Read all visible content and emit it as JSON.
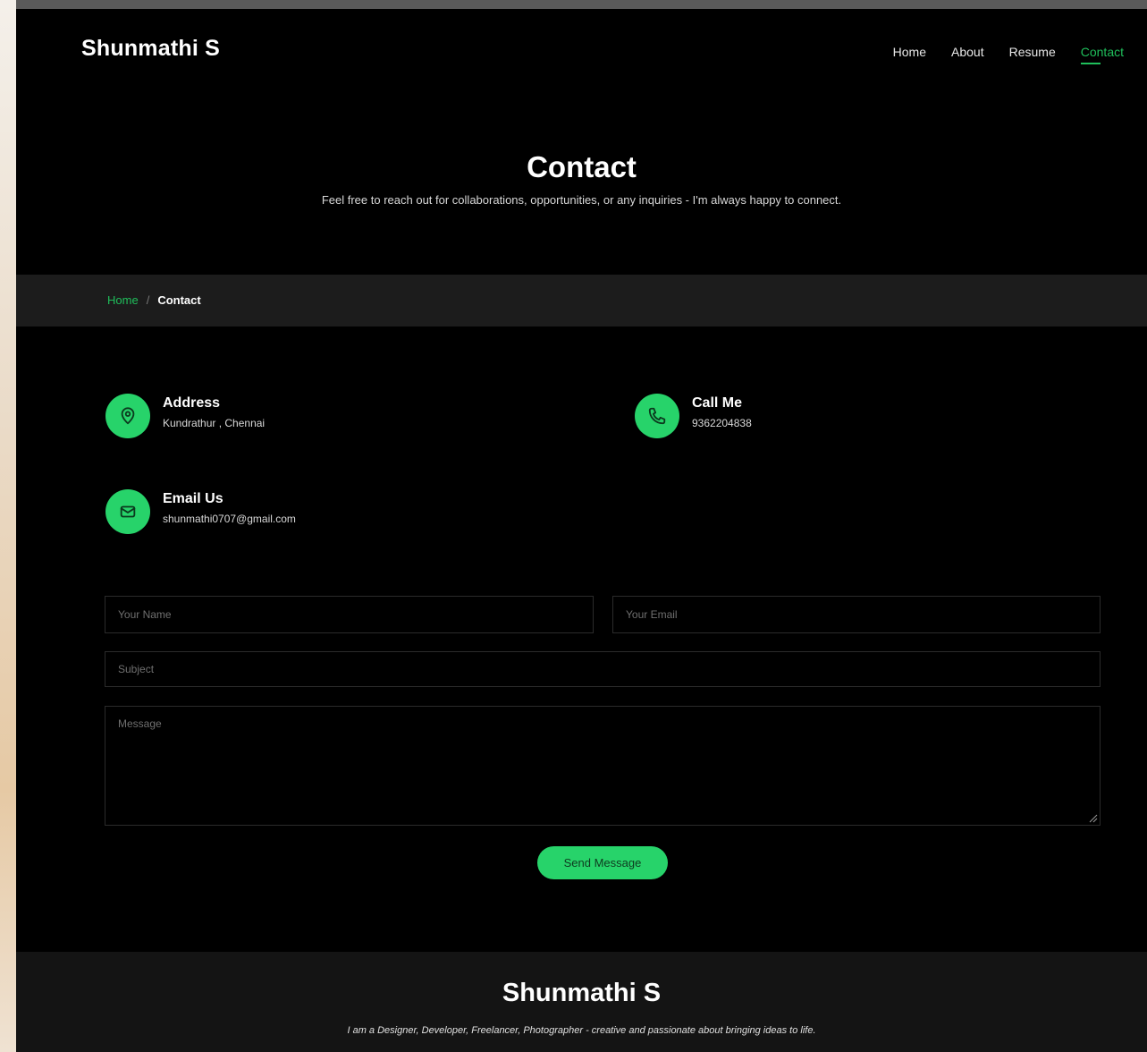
{
  "header": {
    "brand": "Shunmathi S",
    "nav": [
      {
        "label": "Home"
      },
      {
        "label": "About"
      },
      {
        "label": "Resume"
      },
      {
        "label": "Contact"
      }
    ]
  },
  "hero": {
    "title": "Contact",
    "subtitle": "Feel free to reach out for collaborations, opportunities, or any inquiries - I'm always happy to connect."
  },
  "breadcrumb": {
    "home": "Home",
    "separator": "/",
    "current": "Contact"
  },
  "info": {
    "address": {
      "label": "Address",
      "value": "Kundrathur , Chennai"
    },
    "call": {
      "label": "Call Me",
      "value": "9362204838"
    },
    "email": {
      "label": "Email Us",
      "value": "shunmathi0707@gmail.com"
    }
  },
  "form": {
    "name_placeholder": "Your Name",
    "email_placeholder": "Your Email",
    "subject_placeholder": "Subject",
    "message_placeholder": "Message",
    "send_label": "Send Message"
  },
  "footer": {
    "name": "Shunmathi S",
    "tagline": "I am a Designer, Developer, Freelancer, Photographer - creative and passionate about bringing ideas to life."
  },
  "colors": {
    "accent": "#27d36a",
    "background": "#000000",
    "bar": "#1c1c1c"
  },
  "icons": {
    "address": "map-pin-icon",
    "call": "phone-icon",
    "email": "envelope-icon"
  }
}
